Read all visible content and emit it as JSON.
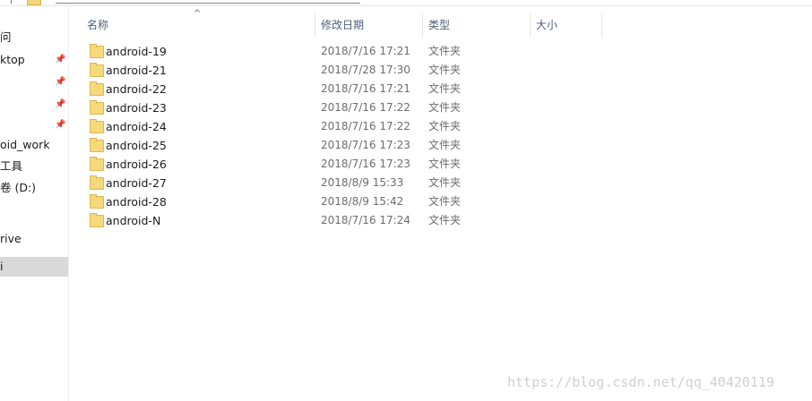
{
  "sidebar": {
    "items": [
      {
        "label": "问",
        "pinned": false
      },
      {
        "label": "ktop",
        "pinned": true
      },
      {
        "label": "",
        "pinned": true
      },
      {
        "label": "",
        "pinned": true
      },
      {
        "label": "",
        "pinned": true
      },
      {
        "label": "oid_work",
        "pinned": false
      },
      {
        "label": "工具",
        "pinned": false
      },
      {
        "label": "卷 (D:)",
        "pinned": false
      },
      {
        "label": "rive",
        "pinned": false
      },
      {
        "label": "i",
        "pinned": false
      }
    ]
  },
  "columns": {
    "name": "名称",
    "date": "修改日期",
    "type": "类型",
    "size": "大小"
  },
  "files": [
    {
      "name": "android-19",
      "date": "2018/7/16 17:21",
      "type": "文件夹"
    },
    {
      "name": "android-21",
      "date": "2018/7/28 17:30",
      "type": "文件夹"
    },
    {
      "name": "android-22",
      "date": "2018/7/16 17:21",
      "type": "文件夹"
    },
    {
      "name": "android-23",
      "date": "2018/7/16 17:22",
      "type": "文件夹"
    },
    {
      "name": "android-24",
      "date": "2018/7/16 17:22",
      "type": "文件夹"
    },
    {
      "name": "android-25",
      "date": "2018/7/16 17:23",
      "type": "文件夹"
    },
    {
      "name": "android-26",
      "date": "2018/7/16 17:23",
      "type": "文件夹"
    },
    {
      "name": "android-27",
      "date": "2018/8/9 15:33",
      "type": "文件夹"
    },
    {
      "name": "android-28",
      "date": "2018/8/9 15:42",
      "type": "文件夹"
    },
    {
      "name": "android-N",
      "date": "2018/7/16 17:24",
      "type": "文件夹"
    }
  ],
  "watermark": "https://blog.csdn.net/qq_40420119",
  "icons": {
    "folder": "folder-icon",
    "pin": "pin-icon",
    "sort": "sort-caret-icon"
  },
  "colors": {
    "folder": "#f6d97a",
    "header_text": "#4c607a",
    "selected": "#d9d9d9"
  }
}
